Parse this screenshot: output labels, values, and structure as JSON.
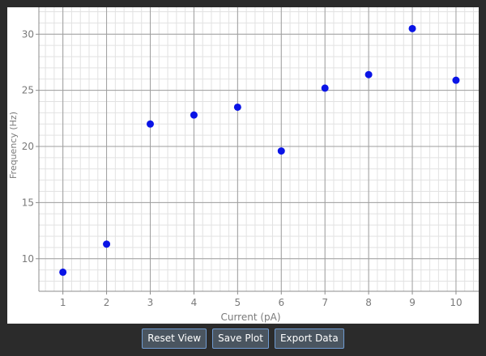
{
  "chart_data": {
    "type": "scatter",
    "title": "",
    "xlabel": "Current (pA)",
    "ylabel": "Frequency (Hz)",
    "x": [
      1,
      2,
      3,
      4,
      5,
      6,
      7,
      8,
      9,
      10
    ],
    "y": [
      8.8,
      11.3,
      22.0,
      22.8,
      23.5,
      19.6,
      25.2,
      26.4,
      30.5,
      25.9
    ],
    "xlim": [
      0.45,
      10.52
    ],
    "ylim": [
      7.1,
      32.4
    ],
    "xticks": [
      1,
      2,
      3,
      4,
      5,
      6,
      7,
      8,
      9,
      10
    ],
    "yticks": [
      10,
      15,
      20,
      25,
      30
    ],
    "grid": true,
    "minor_grid": true,
    "marker_color": "#0a14e6",
    "grid_major_color": "#9e9e9e",
    "grid_minor_color": "#e2e2e2",
    "axis_color": "#8c8c8c",
    "tick_label_color": "#7a7a7a"
  },
  "toolbar": {
    "reset_label": "Reset View",
    "save_label": "Save Plot",
    "export_label": "Export Data"
  }
}
